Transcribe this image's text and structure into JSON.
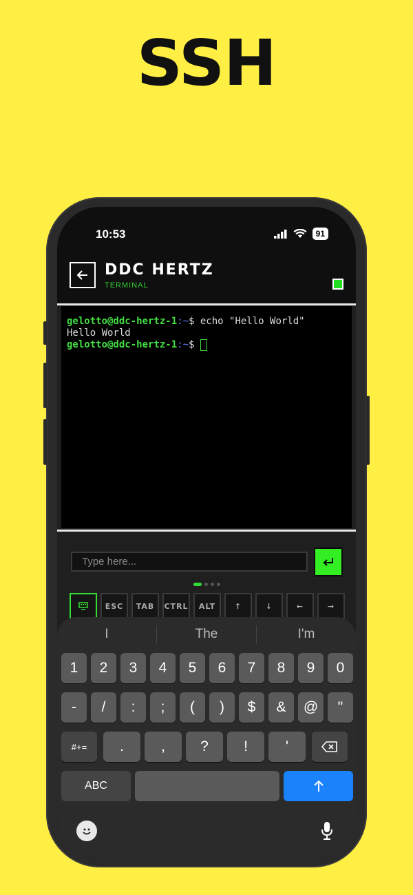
{
  "promo": {
    "headline": "SSH"
  },
  "status_bar": {
    "time": "10:53",
    "battery": "91"
  },
  "header": {
    "back_icon": "arrow-left-icon",
    "title": "DDC HERTZ",
    "subtitle": "TERMINAL",
    "connection_color": "#22dd22"
  },
  "terminal": {
    "lines": [
      {
        "user": "gelotto@ddc-hertz-1",
        "path": ":~",
        "prompt": "$ ",
        "command": "echo \"Hello World\""
      },
      {
        "output": "Hello World"
      },
      {
        "user": "gelotto@ddc-hertz-1",
        "path": ":~",
        "prompt": "$ ",
        "command": ""
      }
    ]
  },
  "input": {
    "placeholder": "Type here...",
    "send_icon": "return-arrow-icon"
  },
  "special_keys": [
    {
      "label": "",
      "icon": "keyboard-icon"
    },
    {
      "label": "ESC"
    },
    {
      "label": "TAB"
    },
    {
      "label": "CTRL"
    },
    {
      "label": "ALT"
    },
    {
      "label": "↑"
    },
    {
      "label": "↓"
    },
    {
      "label": "←"
    },
    {
      "label": "→"
    }
  ],
  "keyboard": {
    "suggestions": [
      "I",
      "The",
      "I'm"
    ],
    "row1": [
      "1",
      "2",
      "3",
      "4",
      "5",
      "6",
      "7",
      "8",
      "9",
      "0"
    ],
    "row2": [
      "-",
      "/",
      ":",
      ";",
      "(",
      ")",
      "$",
      "&",
      "@",
      "\""
    ],
    "row3": [
      ".",
      ",",
      "?",
      "!",
      "'"
    ],
    "shift_label": "#+=",
    "abc_label": "ABC",
    "return_icon": "arrow-up-icon"
  },
  "accent_color": "#33ee22"
}
